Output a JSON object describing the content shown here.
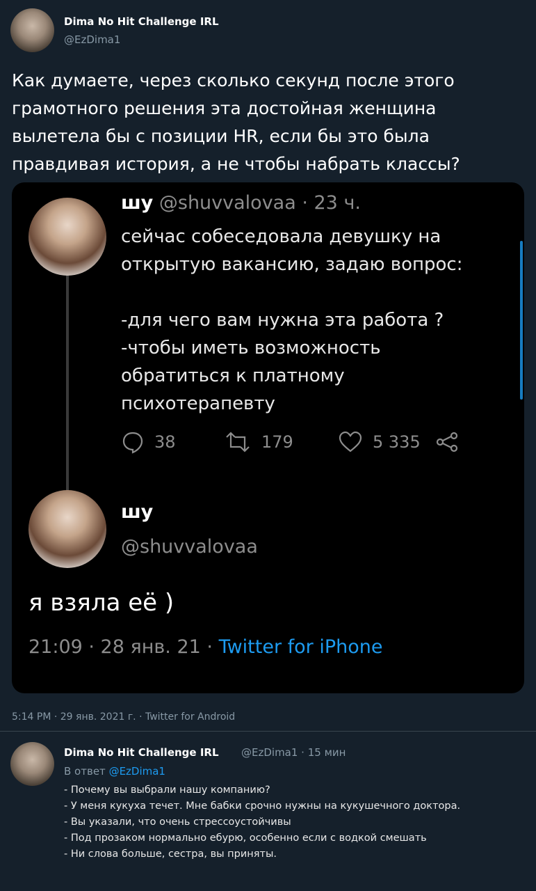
{
  "tweet": {
    "author_name": "Dima No Hit Challenge IRL",
    "author_handle": "@EzDima1",
    "text": "Как думаете, через сколько секунд после этого грамотного решения эта достойная женщина вылетела бы с позиции HR, если бы это была правдивая история, а не чтобы набрать классы?",
    "timestamp": "5:14 PM · 29 янв. 2021 г. · Twitter for Android"
  },
  "embedded": {
    "first": {
      "name": "шу",
      "handle_time": "@shuvvalovaa · 23 ч.",
      "text": "сейчас собеседовала девушку на\nоткрытую вакансию, задаю вопрос:\n\n-для чего вам нужна эта работа ?\n-чтобы иметь возможность\nобратиться к платному\nпсихотерапевту",
      "replies": "38",
      "retweets": "179",
      "likes": "5 335"
    },
    "second": {
      "name": "шу",
      "handle": "@shuvvalovaa",
      "text": "я взяла её )",
      "time": "21:09 · 28 янв. 21 · ",
      "source": "Twitter for iPhone"
    }
  },
  "reply": {
    "author_name": "Dima No Hit Challenge IRL",
    "handle_time": "@EzDima1 · 15 мин",
    "reply_to_prefix": "В ответ ",
    "reply_to_handle": "@EzDima1",
    "lines": [
      "- Почему вы выбрали нашу компанию?",
      "- У меня кукуха течет. Мне бабки срочно нужны на кукушечного доктора.",
      "- Вы указали, что очень стрессоустойчивы",
      "- Под прозаком нормально ебурю, особенно если с водкой смешать",
      "- Ни слова больше, сестра, вы приняты."
    ]
  },
  "colors": {
    "background": "#15202b",
    "embed_background": "#000000",
    "link": "#1d9bf0",
    "muted": "#8899a6"
  }
}
